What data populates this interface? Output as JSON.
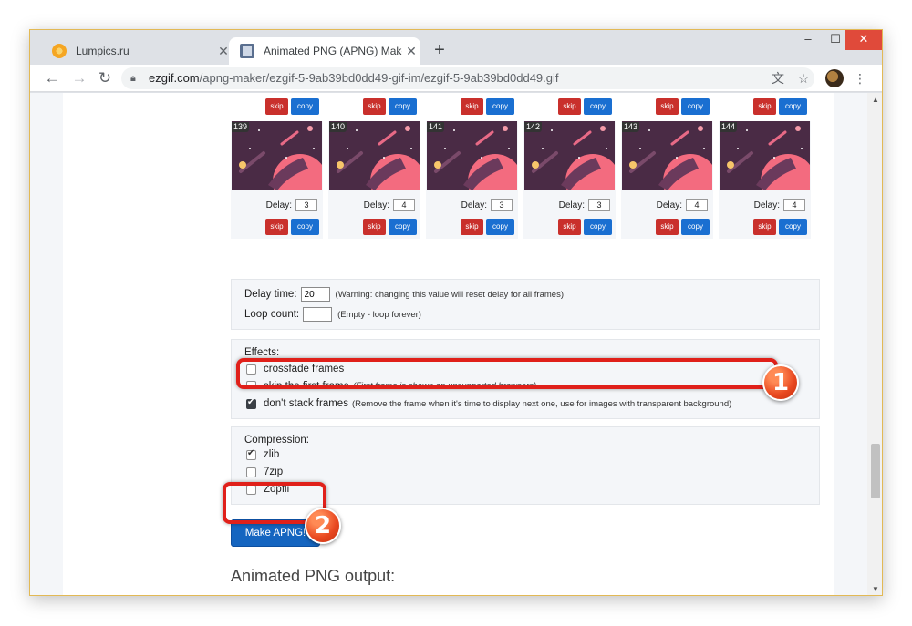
{
  "browser": {
    "tabs": [
      {
        "title": "Lumpics.ru",
        "active": false,
        "icon": "lumpics-favicon"
      },
      {
        "title": "Animated PNG (APNG) Maker",
        "active": true,
        "icon": "ezgif-favicon"
      }
    ],
    "new_tab_label": "+",
    "url_host": "ezgif.com",
    "url_path": "/apng-maker/ezgif-5-9ab39bd0dd49-gif-im/ezgif-5-9ab39bd0dd49.gif"
  },
  "frames": {
    "skip_label": "skip",
    "copy_label": "copy",
    "delay_label": "Delay:",
    "items": [
      {
        "number": "139",
        "delay": "3"
      },
      {
        "number": "140",
        "delay": "4"
      },
      {
        "number": "141",
        "delay": "3"
      },
      {
        "number": "142",
        "delay": "3"
      },
      {
        "number": "143",
        "delay": "4"
      },
      {
        "number": "144",
        "delay": "4"
      }
    ]
  },
  "timing": {
    "delay_time_label": "Delay time:",
    "delay_time_value": "20",
    "delay_time_hint": "(Warning: changing this value will reset delay for all frames)",
    "loop_count_label": "Loop count:",
    "loop_count_value": "",
    "loop_count_hint": "(Empty - loop forever)"
  },
  "effects": {
    "title": "Effects:",
    "options": [
      {
        "label": "crossfade frames",
        "hint": "",
        "checked": false
      },
      {
        "label": "skip the first frame",
        "hint": "(First frame is shown on unsupported browsers)",
        "checked": false
      },
      {
        "label": "don't stack frames",
        "hint": "(Remove the frame when it's time to display next one, use for images with transparent background)",
        "checked": true
      }
    ]
  },
  "compression": {
    "title": "Compression:",
    "options": [
      {
        "label": "zlib",
        "checked": true
      },
      {
        "label": "7zip",
        "checked": false
      },
      {
        "label": "Zopfli",
        "checked": false
      }
    ]
  },
  "make_button_label": "Make APNG!",
  "output_heading": "Animated PNG output:",
  "annotations": {
    "step1": "1",
    "step2": "2",
    "color": "#e0201a"
  }
}
